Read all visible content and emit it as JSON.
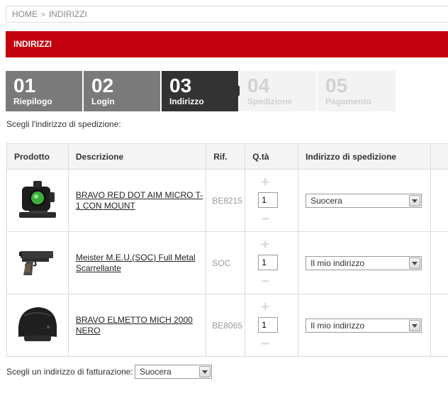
{
  "breadcrumb": {
    "home": "HOME",
    "separator": ">",
    "current": "INDIRIZZI"
  },
  "page_title": "INDIRIZZI",
  "steps": [
    {
      "num": "01",
      "label": "Riepilogo",
      "state": "done"
    },
    {
      "num": "02",
      "label": "Login",
      "state": "done"
    },
    {
      "num": "03",
      "label": "Indirizzo",
      "state": "active"
    },
    {
      "num": "04",
      "label": "Spedizione",
      "state": "future"
    },
    {
      "num": "05",
      "label": "Pagamento",
      "state": "future"
    }
  ],
  "intro": "Scegli l'indirizzo di spedizione:",
  "table": {
    "headers": [
      "Prodotto",
      "Descrizione",
      "Rif.",
      "Q.tà",
      "Indirizzo di spedizione"
    ],
    "rows": [
      {
        "description": "BRAVO RED DOT AIM MICRO T-1 CON MOUNT",
        "ref": "BE8215",
        "qty": "1",
        "address": "Suocera",
        "image": "red-dot-sight-image"
      },
      {
        "description": "Meister M.E.U.(SOC) Full Metal Scarrellante",
        "ref": "SOC",
        "qty": "1",
        "address": "Il mio indirizzo",
        "image": "pistol-image"
      },
      {
        "description": "BRAVO ELMETTO MICH 2000 NERO",
        "ref": "BE8065",
        "qty": "1",
        "address": "Il mio indirizzo",
        "image": "helmet-image"
      }
    ]
  },
  "billing": {
    "label": "Scegli un indirizzo di fatturazione:",
    "value": "Suocera"
  },
  "colors": {
    "accent": "#c3000d",
    "step_done": "#7a7a7a",
    "step_active": "#333333",
    "step_future": "#f3f3f3"
  },
  "icons": {
    "qty_plus": "plus-icon",
    "qty_minus": "minus-icon",
    "dropdown": "chevron-down-icon"
  }
}
